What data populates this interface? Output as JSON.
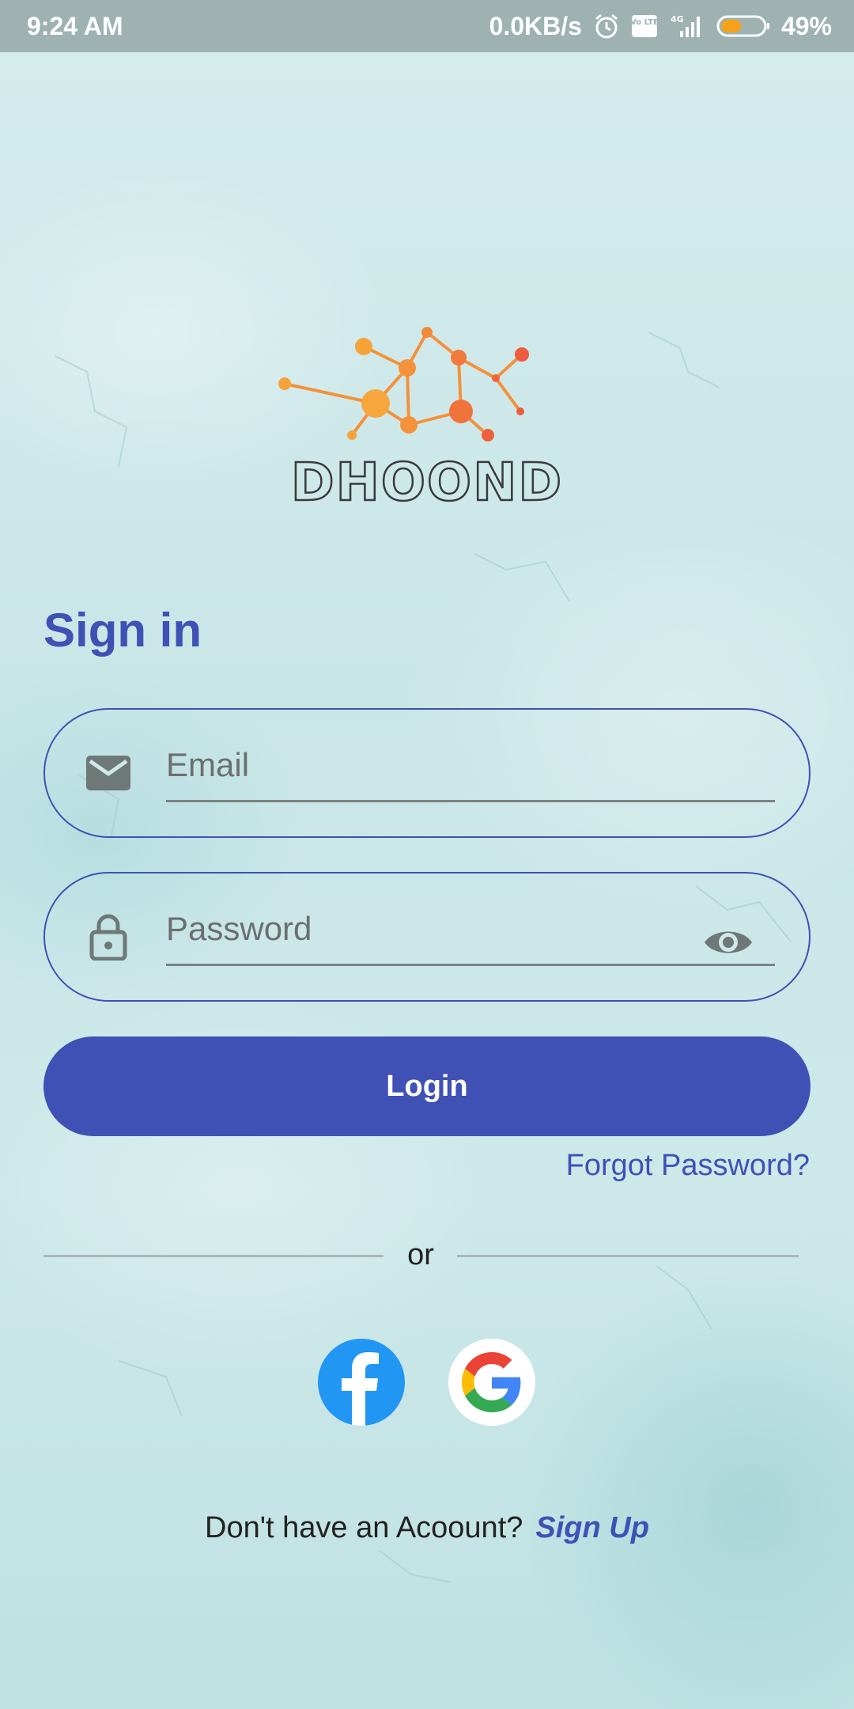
{
  "status_bar": {
    "time": "9:24 AM",
    "network_speed": "0.0KB/s",
    "volte_label": "Vo LTE",
    "network_type": "4G",
    "battery_percent": "49%",
    "battery_level": 0.49,
    "icons": [
      "alarm-icon",
      "volte-icon",
      "signal-icon",
      "battery-icon"
    ]
  },
  "logo": {
    "text": "DHOOND"
  },
  "signin": {
    "title": "Sign in",
    "email_placeholder": "Email",
    "password_placeholder": "Password",
    "login_label": "Login",
    "forgot_label": "Forgot Password?",
    "or_label": "or",
    "no_account_text": "Don't have an Acoount?",
    "signup_label": "Sign Up"
  },
  "social": {
    "facebook_letter": "f"
  },
  "colors": {
    "accent": "#3f51b5",
    "status_bar": "#9eb2b2",
    "facebook": "#2196f3",
    "logo_orange": "#f4913a",
    "icon_grey": "#6e7877"
  }
}
